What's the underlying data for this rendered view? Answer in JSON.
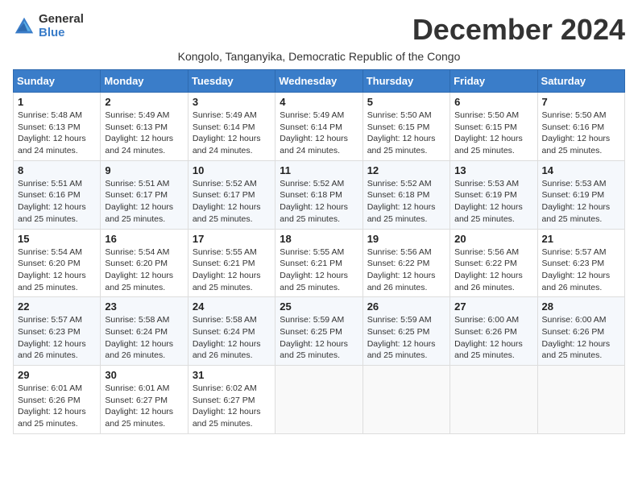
{
  "logo": {
    "general": "General",
    "blue": "Blue"
  },
  "title": "December 2024",
  "location": "Kongolo, Tanganyika, Democratic Republic of the Congo",
  "days_of_week": [
    "Sunday",
    "Monday",
    "Tuesday",
    "Wednesday",
    "Thursday",
    "Friday",
    "Saturday"
  ],
  "weeks": [
    [
      {
        "day": "1",
        "sunrise": "5:48 AM",
        "sunset": "6:13 PM",
        "daylight": "12 hours and 24 minutes."
      },
      {
        "day": "2",
        "sunrise": "5:49 AM",
        "sunset": "6:13 PM",
        "daylight": "12 hours and 24 minutes."
      },
      {
        "day": "3",
        "sunrise": "5:49 AM",
        "sunset": "6:14 PM",
        "daylight": "12 hours and 24 minutes."
      },
      {
        "day": "4",
        "sunrise": "5:49 AM",
        "sunset": "6:14 PM",
        "daylight": "12 hours and 24 minutes."
      },
      {
        "day": "5",
        "sunrise": "5:50 AM",
        "sunset": "6:15 PM",
        "daylight": "12 hours and 25 minutes."
      },
      {
        "day": "6",
        "sunrise": "5:50 AM",
        "sunset": "6:15 PM",
        "daylight": "12 hours and 25 minutes."
      },
      {
        "day": "7",
        "sunrise": "5:50 AM",
        "sunset": "6:16 PM",
        "daylight": "12 hours and 25 minutes."
      }
    ],
    [
      {
        "day": "8",
        "sunrise": "5:51 AM",
        "sunset": "6:16 PM",
        "daylight": "12 hours and 25 minutes."
      },
      {
        "day": "9",
        "sunrise": "5:51 AM",
        "sunset": "6:17 PM",
        "daylight": "12 hours and 25 minutes."
      },
      {
        "day": "10",
        "sunrise": "5:52 AM",
        "sunset": "6:17 PM",
        "daylight": "12 hours and 25 minutes."
      },
      {
        "day": "11",
        "sunrise": "5:52 AM",
        "sunset": "6:18 PM",
        "daylight": "12 hours and 25 minutes."
      },
      {
        "day": "12",
        "sunrise": "5:52 AM",
        "sunset": "6:18 PM",
        "daylight": "12 hours and 25 minutes."
      },
      {
        "day": "13",
        "sunrise": "5:53 AM",
        "sunset": "6:19 PM",
        "daylight": "12 hours and 25 minutes."
      },
      {
        "day": "14",
        "sunrise": "5:53 AM",
        "sunset": "6:19 PM",
        "daylight": "12 hours and 25 minutes."
      }
    ],
    [
      {
        "day": "15",
        "sunrise": "5:54 AM",
        "sunset": "6:20 PM",
        "daylight": "12 hours and 25 minutes."
      },
      {
        "day": "16",
        "sunrise": "5:54 AM",
        "sunset": "6:20 PM",
        "daylight": "12 hours and 25 minutes."
      },
      {
        "day": "17",
        "sunrise": "5:55 AM",
        "sunset": "6:21 PM",
        "daylight": "12 hours and 25 minutes."
      },
      {
        "day": "18",
        "sunrise": "5:55 AM",
        "sunset": "6:21 PM",
        "daylight": "12 hours and 25 minutes."
      },
      {
        "day": "19",
        "sunrise": "5:56 AM",
        "sunset": "6:22 PM",
        "daylight": "12 hours and 26 minutes."
      },
      {
        "day": "20",
        "sunrise": "5:56 AM",
        "sunset": "6:22 PM",
        "daylight": "12 hours and 26 minutes."
      },
      {
        "day": "21",
        "sunrise": "5:57 AM",
        "sunset": "6:23 PM",
        "daylight": "12 hours and 26 minutes."
      }
    ],
    [
      {
        "day": "22",
        "sunrise": "5:57 AM",
        "sunset": "6:23 PM",
        "daylight": "12 hours and 26 minutes."
      },
      {
        "day": "23",
        "sunrise": "5:58 AM",
        "sunset": "6:24 PM",
        "daylight": "12 hours and 26 minutes."
      },
      {
        "day": "24",
        "sunrise": "5:58 AM",
        "sunset": "6:24 PM",
        "daylight": "12 hours and 26 minutes."
      },
      {
        "day": "25",
        "sunrise": "5:59 AM",
        "sunset": "6:25 PM",
        "daylight": "12 hours and 25 minutes."
      },
      {
        "day": "26",
        "sunrise": "5:59 AM",
        "sunset": "6:25 PM",
        "daylight": "12 hours and 25 minutes."
      },
      {
        "day": "27",
        "sunrise": "6:00 AM",
        "sunset": "6:26 PM",
        "daylight": "12 hours and 25 minutes."
      },
      {
        "day": "28",
        "sunrise": "6:00 AM",
        "sunset": "6:26 PM",
        "daylight": "12 hours and 25 minutes."
      }
    ],
    [
      {
        "day": "29",
        "sunrise": "6:01 AM",
        "sunset": "6:26 PM",
        "daylight": "12 hours and 25 minutes."
      },
      {
        "day": "30",
        "sunrise": "6:01 AM",
        "sunset": "6:27 PM",
        "daylight": "12 hours and 25 minutes."
      },
      {
        "day": "31",
        "sunrise": "6:02 AM",
        "sunset": "6:27 PM",
        "daylight": "12 hours and 25 minutes."
      },
      null,
      null,
      null,
      null
    ]
  ]
}
